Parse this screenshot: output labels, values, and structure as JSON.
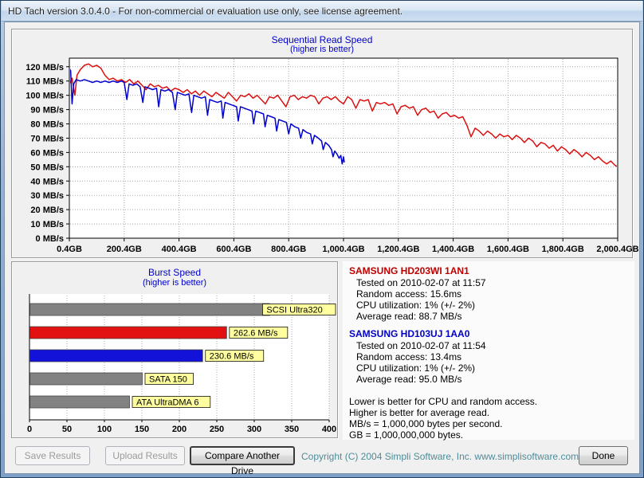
{
  "window": {
    "title": "HD Tach version 3.0.4.0  - For non-commercial or evaluation use only, see license agreement."
  },
  "chart_data": [
    {
      "type": "line",
      "title": "Sequential Read Speed",
      "subtitle": "(higher is better)",
      "xlim": [
        0,
        2000
      ],
      "ylim": [
        0,
        126
      ],
      "grid": true,
      "x_ticks": [
        "0.4GB",
        "200.4GB",
        "400.4GB",
        "600.4GB",
        "800.4GB",
        "1,000.4GB",
        "1,200.4GB",
        "1,400.4GB",
        "1,600.4GB",
        "1,800.4GB",
        "2,000.4GB"
      ],
      "y_ticks": [
        "120 MB/s",
        "110 MB/s",
        "100 MB/s",
        "90 MB/s",
        "80 MB/s",
        "70 MB/s",
        "60 MB/s",
        "50 MB/s",
        "40 MB/s",
        "30 MB/s",
        "20 MB/s",
        "10 MB/s",
        "0 MB/s"
      ],
      "series": [
        {
          "name": "SAMSUNG HD203WI 1AN1",
          "color": "#dd1010",
          "points": [
            [
              0,
              108
            ],
            [
              10,
              112
            ],
            [
              20,
              100
            ],
            [
              28,
              114
            ],
            [
              40,
              118
            ],
            [
              55,
              121
            ],
            [
              70,
              122
            ],
            [
              85,
              120
            ],
            [
              100,
              121
            ],
            [
              115,
              119
            ],
            [
              130,
              114
            ],
            [
              145,
              111
            ],
            [
              160,
              112
            ],
            [
              175,
              110
            ],
            [
              190,
              111
            ],
            [
              205,
              109
            ],
            [
              220,
              111
            ],
            [
              235,
              108
            ],
            [
              250,
              110
            ],
            [
              265,
              107
            ],
            [
              280,
              104
            ],
            [
              295,
              108
            ],
            [
              310,
              106
            ],
            [
              325,
              107
            ],
            [
              340,
              105
            ],
            [
              355,
              106
            ],
            [
              370,
              103
            ],
            [
              385,
              105
            ],
            [
              400,
              104
            ],
            [
              415,
              102
            ],
            [
              430,
              104
            ],
            [
              445,
              101
            ],
            [
              460,
              103
            ],
            [
              475,
              100
            ],
            [
              490,
              103
            ],
            [
              505,
              101
            ],
            [
              520,
              99
            ],
            [
              535,
              102
            ],
            [
              550,
              100
            ],
            [
              565,
              98
            ],
            [
              580,
              102
            ],
            [
              595,
              99
            ],
            [
              610,
              96
            ],
            [
              625,
              100
            ],
            [
              640,
              99
            ],
            [
              655,
              101
            ],
            [
              670,
              98
            ],
            [
              685,
              100
            ],
            [
              700,
              97
            ],
            [
              715,
              94
            ],
            [
              730,
              99
            ],
            [
              745,
              98
            ],
            [
              760,
              100
            ],
            [
              775,
              96
            ],
            [
              790,
              92
            ],
            [
              805,
              99
            ],
            [
              820,
              100
            ],
            [
              835,
              97
            ],
            [
              850,
              99
            ],
            [
              865,
              98
            ],
            [
              880,
              100
            ],
            [
              895,
              99
            ],
            [
              910,
              94
            ],
            [
              925,
              98
            ],
            [
              940,
              99
            ],
            [
              955,
              97
            ],
            [
              970,
              99
            ],
            [
              985,
              96
            ],
            [
              1000,
              94
            ],
            [
              1015,
              99
            ],
            [
              1030,
              97
            ],
            [
              1045,
              91
            ],
            [
              1060,
              97
            ],
            [
              1075,
              96
            ],
            [
              1090,
              97
            ],
            [
              1105,
              89
            ],
            [
              1120,
              95
            ],
            [
              1135,
              94
            ],
            [
              1150,
              95
            ],
            [
              1165,
              93
            ],
            [
              1180,
              94
            ],
            [
              1195,
              87
            ],
            [
              1210,
              92
            ],
            [
              1225,
              93
            ],
            [
              1240,
              91
            ],
            [
              1255,
              92
            ],
            [
              1270,
              86
            ],
            [
              1285,
              90
            ],
            [
              1300,
              91
            ],
            [
              1315,
              88
            ],
            [
              1330,
              89
            ],
            [
              1345,
              84
            ],
            [
              1360,
              87
            ],
            [
              1375,
              88
            ],
            [
              1390,
              85
            ],
            [
              1405,
              86
            ],
            [
              1420,
              84
            ],
            [
              1435,
              85
            ],
            [
              1450,
              79
            ],
            [
              1465,
              71
            ],
            [
              1480,
              77
            ],
            [
              1495,
              75
            ],
            [
              1510,
              72
            ],
            [
              1525,
              75
            ],
            [
              1540,
              73
            ],
            [
              1555,
              70
            ],
            [
              1570,
              73
            ],
            [
              1585,
              71
            ],
            [
              1600,
              72
            ],
            [
              1615,
              69
            ],
            [
              1630,
              72
            ],
            [
              1645,
              70
            ],
            [
              1660,
              67
            ],
            [
              1675,
              70
            ],
            [
              1690,
              68
            ],
            [
              1705,
              64
            ],
            [
              1720,
              67
            ],
            [
              1735,
              66
            ],
            [
              1750,
              63
            ],
            [
              1765,
              65
            ],
            [
              1780,
              61
            ],
            [
              1795,
              64
            ],
            [
              1810,
              62
            ],
            [
              1825,
              59
            ],
            [
              1840,
              62
            ],
            [
              1855,
              60
            ],
            [
              1870,
              57
            ],
            [
              1885,
              60
            ],
            [
              1900,
              58
            ],
            [
              1915,
              55
            ],
            [
              1930,
              57
            ],
            [
              1945,
              54
            ],
            [
              1960,
              52
            ],
            [
              1975,
              54
            ],
            [
              1990,
              51
            ],
            [
              2000,
              50
            ]
          ]
        },
        {
          "name": "SAMSUNG HD103UJ 1AA0",
          "color": "#0000d0",
          "points": [
            [
              0,
              119
            ],
            [
              5,
              117
            ],
            [
              10,
              94
            ],
            [
              16,
              108
            ],
            [
              25,
              111
            ],
            [
              40,
              110
            ],
            [
              55,
              111
            ],
            [
              70,
              110
            ],
            [
              85,
              109
            ],
            [
              100,
              110
            ],
            [
              115,
              109
            ],
            [
              130,
              110
            ],
            [
              145,
              109
            ],
            [
              160,
              110
            ],
            [
              175,
              109
            ],
            [
              190,
              110
            ],
            [
              200,
              109
            ],
            [
              210,
              97
            ],
            [
              218,
              108
            ],
            [
              232,
              107
            ],
            [
              246,
              108
            ],
            [
              258,
              106
            ],
            [
              268,
              95
            ],
            [
              276,
              106
            ],
            [
              290,
              105
            ],
            [
              304,
              104
            ],
            [
              318,
              105
            ],
            [
              326,
              92
            ],
            [
              334,
              104
            ],
            [
              348,
              103
            ],
            [
              362,
              104
            ],
            [
              376,
              102
            ],
            [
              386,
              90
            ],
            [
              394,
              102
            ],
            [
              408,
              101
            ],
            [
              422,
              100
            ],
            [
              436,
              101
            ],
            [
              446,
              88
            ],
            [
              454,
              100
            ],
            [
              468,
              99
            ],
            [
              482,
              98
            ],
            [
              496,
              99
            ],
            [
              504,
              86
            ],
            [
              512,
              97
            ],
            [
              526,
              96
            ],
            [
              540,
              95
            ],
            [
              554,
              96
            ],
            [
              560,
              84
            ],
            [
              568,
              95
            ],
            [
              582,
              94
            ],
            [
              596,
              93
            ],
            [
              610,
              92
            ],
            [
              616,
              82
            ],
            [
              624,
              92
            ],
            [
              638,
              91
            ],
            [
              652,
              90
            ],
            [
              666,
              89
            ],
            [
              672,
              80
            ],
            [
              680,
              89
            ],
            [
              694,
              88
            ],
            [
              708,
              87
            ],
            [
              714,
              78
            ],
            [
              722,
              86
            ],
            [
              736,
              85
            ],
            [
              750,
              84
            ],
            [
              756,
              75
            ],
            [
              764,
              83
            ],
            [
              778,
              82
            ],
            [
              792,
              81
            ],
            [
              800,
              73
            ],
            [
              808,
              80
            ],
            [
              822,
              78
            ],
            [
              836,
              77
            ],
            [
              844,
              70
            ],
            [
              852,
              76
            ],
            [
              866,
              74
            ],
            [
              880,
              73
            ],
            [
              886,
              66
            ],
            [
              894,
              72
            ],
            [
              908,
              70
            ],
            [
              920,
              68
            ],
            [
              926,
              62
            ],
            [
              934,
              67
            ],
            [
              946,
              65
            ],
            [
              956,
              62
            ],
            [
              962,
              57
            ],
            [
              968,
              61
            ],
            [
              976,
              59
            ],
            [
              984,
              56
            ],
            [
              990,
              58
            ],
            [
              995,
              52
            ],
            [
              1000,
              57
            ],
            [
              1003,
              53
            ]
          ]
        }
      ]
    },
    {
      "type": "bar",
      "title": "Burst Speed",
      "subtitle": "(higher is better)",
      "orientation": "horizontal",
      "xlim": [
        0,
        400
      ],
      "x_ticks": [
        0,
        50,
        100,
        150,
        200,
        250,
        300,
        350,
        400
      ],
      "label_bg": "#ffffa0",
      "bars": [
        {
          "label": "SCSI Ultra320",
          "value": 320,
          "color": "#828282"
        },
        {
          "label": "262.6 MB/s",
          "value": 262.6,
          "color": "#e21212"
        },
        {
          "label": "230.6 MB/s",
          "value": 230.6,
          "color": "#1212d8"
        },
        {
          "label": "SATA 150",
          "value": 150,
          "color": "#828282"
        },
        {
          "label": "ATA UltraDMA 6",
          "value": 133,
          "color": "#828282"
        }
      ]
    }
  ],
  "info": {
    "drives": [
      {
        "name": "SAMSUNG HD203WI 1AN1",
        "color": "#c00000",
        "lines": [
          "Tested on 2010-02-07 at 11:57",
          "Random access: 15.6ms",
          "CPU utilization: 1% (+/- 2%)",
          "Average read: 88.7 MB/s"
        ]
      },
      {
        "name": "SAMSUNG HD103UJ 1AA0",
        "color": "#0000c8",
        "lines": [
          "Tested on 2010-02-07 at 11:54",
          "Random access: 13.4ms",
          "CPU utilization: 1% (+/- 2%)",
          "Average read: 95.0 MB/s"
        ]
      }
    ],
    "notes": [
      "Lower is better for CPU and random access.",
      "Higher is better for average read.",
      "MB/s = 1,000,000 bytes per second.",
      "GB = 1,000,000,000 bytes."
    ]
  },
  "buttons": {
    "save": "Save Results",
    "upload": "Upload Results",
    "compare": "Compare Another Drive",
    "done": "Done"
  },
  "footer": {
    "copyright": "Copyright (C) 2004 Simpli Software, Inc.  www.simplisoftware.com",
    "copyright_color": "#4e8c99"
  }
}
